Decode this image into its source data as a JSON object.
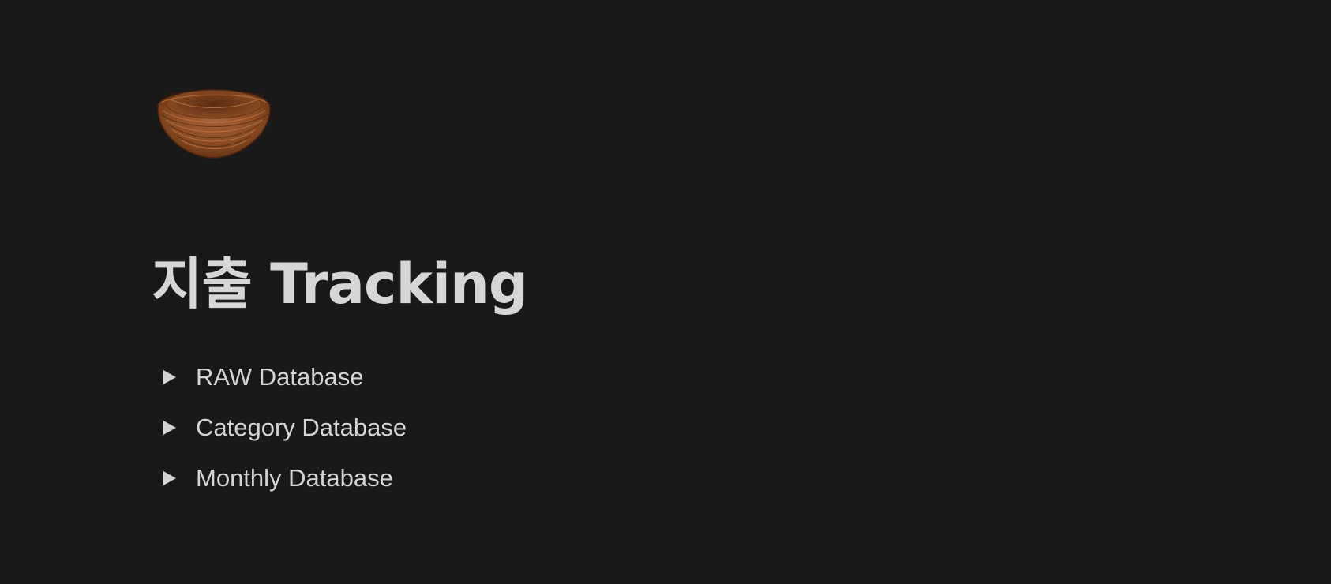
{
  "page": {
    "icon": "nest-icon",
    "title": "지출 Tracking"
  },
  "toggles": [
    {
      "label": "RAW Database",
      "icon": "triangle-right-icon"
    },
    {
      "label": "Category Database",
      "icon": "triangle-right-icon"
    },
    {
      "label": "Monthly Database",
      "icon": "triangle-right-icon"
    }
  ],
  "colors": {
    "background": "#191919",
    "text": "#d4d4d4",
    "nest": "#8b4a22"
  }
}
